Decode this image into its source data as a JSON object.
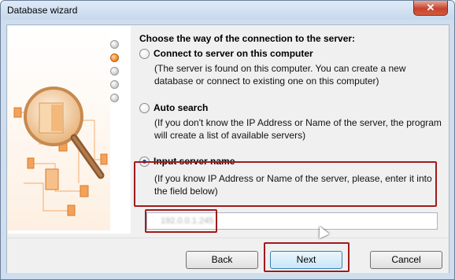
{
  "window": {
    "title": "Database wizard",
    "close_label": "✕"
  },
  "steps": {
    "count": 5,
    "active_index": 1
  },
  "main": {
    "heading": "Choose the way of the connection to the server:",
    "options": [
      {
        "label": "Connect to server on this computer",
        "description": "(The server is found on this computer. You can create a new database or connect to existing one on this computer)",
        "checked": false
      },
      {
        "label": "Auto search",
        "description": "(If you don't know the IP Address or Name of the server, the program will create a list of available servers)",
        "checked": false
      },
      {
        "label": "Input server name",
        "description": "(If you know IP Address or Name of the server, please, enter it into the field below)",
        "checked": true
      }
    ],
    "server_input_value": "192.0.0.1.245"
  },
  "buttons": {
    "back": "Back",
    "next": "Next",
    "cancel": "Cancel"
  },
  "colors": {
    "accent_orange": "#f07f1c",
    "highlight_red": "#a01b1b",
    "window_frame": "#cfdeef"
  }
}
